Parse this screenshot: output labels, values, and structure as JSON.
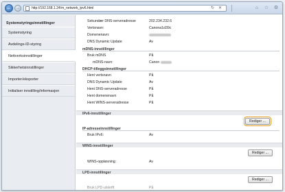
{
  "browser": {
    "url": "http://192.168.1.24/m_network_ipv6.html",
    "back_label": "←",
    "forward_label": "→",
    "refresh_icon": "refresh-icon",
    "stop_icon": "close-icon",
    "toolbar_icons": [
      "home-icon",
      "star-icon",
      "gear-icon"
    ]
  },
  "sidebar": {
    "heading": "Systemstyringsinnstillinger",
    "items": [
      {
        "label": "Systemstyring"
      },
      {
        "label": "Avdelings-ID-styring"
      },
      {
        "label": "Nettverksinnstillinger",
        "active": true
      },
      {
        "label": "Sikkerhetsinnstillinger"
      },
      {
        "label": "Importer/eksporter"
      },
      {
        "label": "Initialiser innstilling/informasjon"
      }
    ]
  },
  "main": {
    "rows_top": [
      {
        "label": "Sekundær DNS-serveradresse",
        "value": "202.234.232.6"
      },
      {
        "label": "Vertsnavn:",
        "value": "Canona1d39c"
      },
      {
        "label": "Domenenavn:",
        "value": "",
        "blurred": true
      },
      {
        "label": "DNS Dynamic Update",
        "value": "Av"
      }
    ],
    "mdns_heading": "mDNS-innstillinger",
    "mdns_rows": [
      {
        "label": "Bruk mDNS",
        "value": "På"
      },
      {
        "label": "mDNS-navn:",
        "value": "Canon"
      }
    ],
    "dhcp_heading": "DHCP-tilleggsinnstillinger",
    "dhcp_rows": [
      {
        "label": "Hent vertsnavn",
        "value": "På"
      },
      {
        "label": "DNS Dynamic Update",
        "value": "Av"
      },
      {
        "label": "Hent DNS-serveradresse",
        "value": "På"
      },
      {
        "label": "Hent domenenavn",
        "value": "På"
      },
      {
        "label": "Hent WINS-serveradresse",
        "value": "På"
      }
    ],
    "ipv6_section": "IPv6-innstillinger",
    "ipv6_edit": "Rediger ...",
    "ip_addr_heading": "IP-adresseinnstillinger",
    "ipv6_rows": [
      {
        "label": "Bruk IPv6:",
        "value": "Av"
      }
    ],
    "wins_section": "WINS-innstillinger",
    "wins_edit": "Rediger ...",
    "wins_rows": [
      {
        "label": "WINS-oppløsning:",
        "value": "Av"
      }
    ],
    "lpd_section": "LPD-innstillinger",
    "lpd_edit": "Rediger ...",
    "lpd_rows": [
      {
        "label": "Bruk LPD-utskrift",
        "value": "På"
      }
    ]
  }
}
